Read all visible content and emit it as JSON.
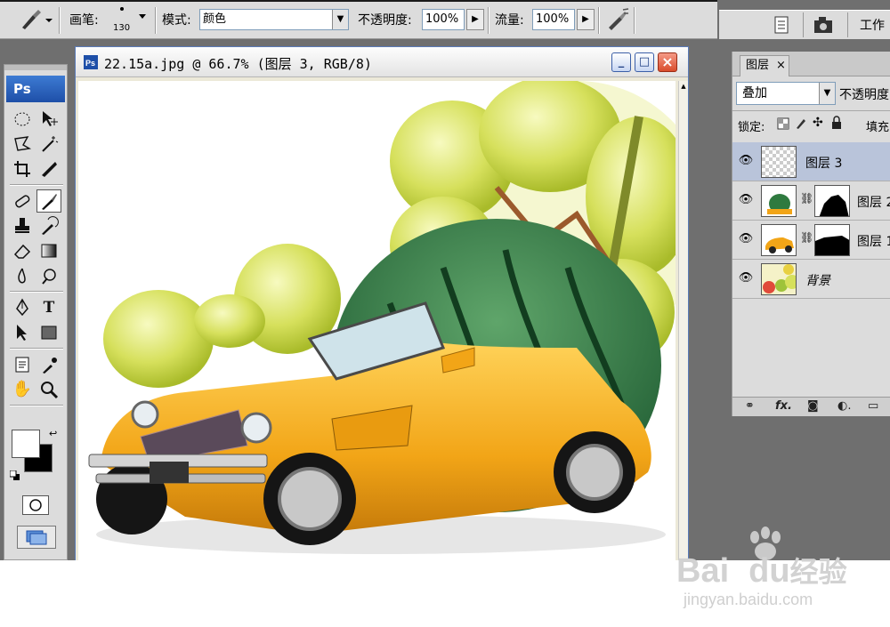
{
  "options_bar": {
    "brush_label": "画笔:",
    "brush_size": "130",
    "mode_label": "模式:",
    "mode_value": "颜色",
    "opacity_label": "不透明度:",
    "opacity_value": "100%",
    "flow_label": "流量:",
    "flow_value": "100%"
  },
  "top_right": {
    "workspace_label": "工作"
  },
  "toolbox": {
    "logo": "Ps"
  },
  "document": {
    "title": "22.15a.jpg @ 66.7% (图层 3, RGB/8)",
    "minimize": "_",
    "maximize": "□",
    "close": "×"
  },
  "layers_panel": {
    "tab_label": "图层",
    "tab_close": "×",
    "blend_mode": "叠加",
    "opacity_label": "不透明度",
    "lock_label": "锁定:",
    "fill_label": "填充",
    "layers": [
      {
        "name": "图层 3",
        "selected": true
      },
      {
        "name": "图层 2",
        "selected": false
      },
      {
        "name": "图层 1",
        "selected": false
      },
      {
        "name": "背景",
        "selected": false
      }
    ],
    "footer_icons": [
      "link-icon",
      "fx-icon",
      "mask-icon",
      "adjustment-icon",
      "folder-icon"
    ]
  },
  "watermark": {
    "brand": "Bai",
    "brand2": "du",
    "suffix": "经验",
    "url": "jingyan.baidu.com"
  },
  "colors": {
    "app_bg": "#6f6f6f",
    "panel_bg": "#dcdcdc",
    "selected_layer": "#b9c4da",
    "ps_logo": "#1e4fa8"
  }
}
